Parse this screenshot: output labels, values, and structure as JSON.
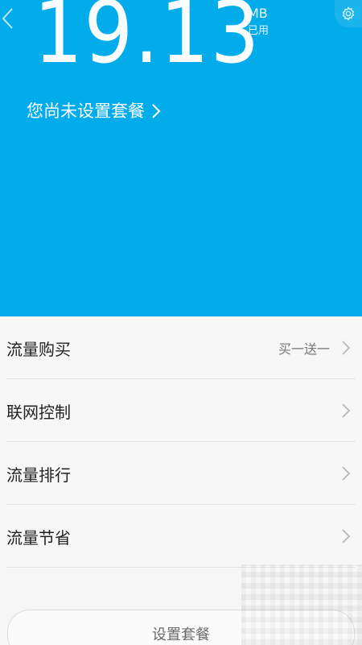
{
  "header": {
    "usage_value": "19.13",
    "usage_unit": "MB",
    "usage_sub": "已用",
    "plan_link_text": "您尚未设置套餐",
    "colors": {
      "background": "#02aceb",
      "text": "#ffffff"
    },
    "icons": {
      "back": "chevron-left-icon",
      "settings": "gear-icon",
      "plan_arrow": "chevron-right-icon"
    }
  },
  "menu": {
    "items": [
      {
        "label": "流量购买",
        "extra": "买一送一"
      },
      {
        "label": "联网控制",
        "extra": ""
      },
      {
        "label": "流量排行",
        "extra": ""
      },
      {
        "label": "流量节省",
        "extra": ""
      }
    ]
  },
  "footer": {
    "setup_button_label": "设置套餐"
  }
}
